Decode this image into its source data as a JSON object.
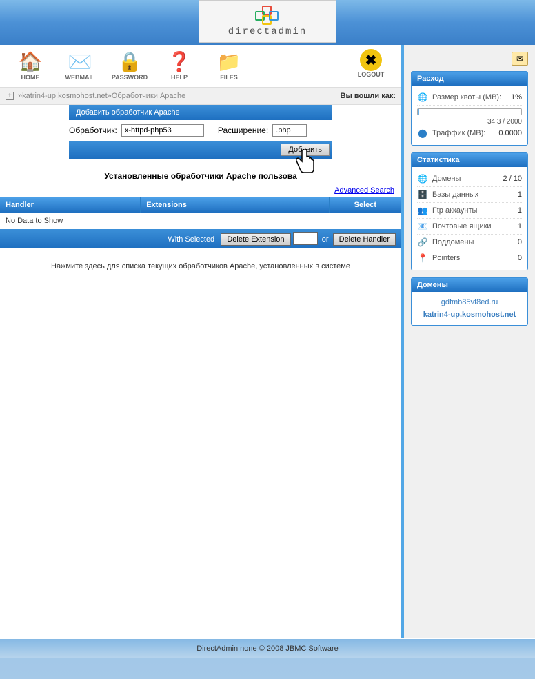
{
  "brand": "directadmin",
  "toolbar": [
    {
      "label": "HOME",
      "icon": "🏠",
      "name": "home"
    },
    {
      "label": "WEBMAIL",
      "icon": "✉️",
      "name": "webmail"
    },
    {
      "label": "PASSWORD",
      "icon": "🔒",
      "name": "password"
    },
    {
      "label": "HELP",
      "icon": "❓",
      "name": "help"
    },
    {
      "label": "FILES",
      "icon": "📁",
      "name": "files"
    }
  ],
  "logout": {
    "label": "LOGOUT",
    "icon": "✖"
  },
  "breadcrumb": {
    "host": "katrin4-up.kosmohost.net",
    "page": "Обработчики Apache",
    "login_as": "Вы вошли как:"
  },
  "form": {
    "title": "Добавить обработчик Apache",
    "handler_label": "Обработчик:",
    "handler_value": "x-httpd-php53",
    "ext_label": "Расширение:",
    "ext_value": ".php",
    "submit": "Добавить"
  },
  "subtitle": "Установленные обработчики Apache пользова",
  "adv_search": "Advanced Search",
  "table": {
    "cols": [
      "Handler",
      "Extensions",
      "Select"
    ],
    "empty": "No Data to Show",
    "with_selected": "With Selected",
    "delete_ext": "Delete Extension",
    "or": "or",
    "delete_handler": "Delete Handler"
  },
  "hint": "Нажмите здесь для списка текущих обработчиков Apache, установленных в системе",
  "side": {
    "usage": {
      "title": "Расход",
      "quota_label": "Размер квоты (MB):",
      "quota_pct": "1%",
      "quota_text": "34.3 / 2000",
      "traffic_label": "Траффик (MB):",
      "traffic_val": "0.0000"
    },
    "stats": {
      "title": "Статистика",
      "rows": [
        {
          "icon": "🌐",
          "label": "Домены",
          "val": "2 / 10"
        },
        {
          "icon": "🗄️",
          "label": "Базы данных",
          "val": "1"
        },
        {
          "icon": "👥",
          "label": "Ftp аккаунты",
          "val": "1"
        },
        {
          "icon": "📧",
          "label": "Почтовые ящики",
          "val": "1"
        },
        {
          "icon": "🔗",
          "label": "Поддомены",
          "val": "0"
        },
        {
          "icon": "📍",
          "label": "Pointers",
          "val": "0"
        }
      ]
    },
    "domains": {
      "title": "Домены",
      "list": [
        {
          "name": "gdfmb85vf8ed.ru",
          "active": false
        },
        {
          "name": "katrin4-up.kosmohost.net",
          "active": true
        }
      ]
    }
  },
  "footer": "DirectAdmin none © 2008 JBMC Software"
}
